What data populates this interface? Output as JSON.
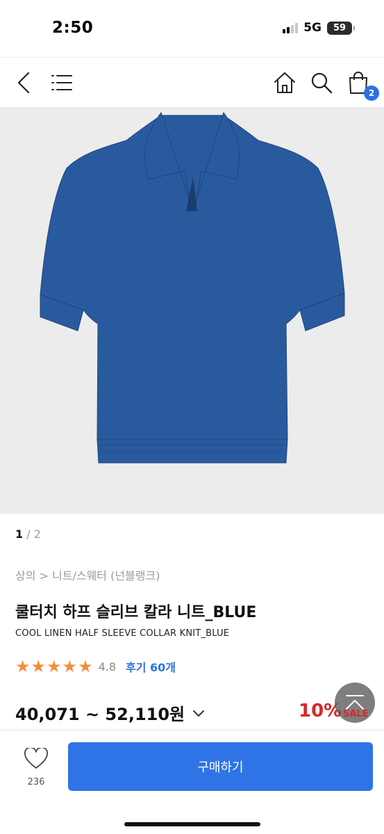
{
  "status_bar": {
    "time": "2:50",
    "network": "5G",
    "battery": "59"
  },
  "nav": {
    "cart_count": "2"
  },
  "gallery": {
    "current": "1",
    "separator": " / ",
    "total": "2"
  },
  "product": {
    "breadcrumb": "상의 > 니트/스웨터 (넌블랭크)",
    "title": "쿨터치 하프 슬리브 칼라 니트_BLUE",
    "subtitle": "COOL LINEN HALF SLEEVE COLLAR KNIT_BLUE",
    "rating": "4.8",
    "rating_value": 4.8,
    "reviews": "후기 60개",
    "price": "40,071 ~ 52,110원",
    "discount": "10%",
    "sale": "SALE",
    "shirt_color": "#2a5a9e"
  },
  "bottom_bar": {
    "wishlist_count": "236",
    "buy_label": "구매하기",
    "buy_color": "#2f74e6"
  },
  "colors": {
    "accent": "#2b72e3",
    "star": "#f0903a",
    "sale": "#d62828"
  }
}
